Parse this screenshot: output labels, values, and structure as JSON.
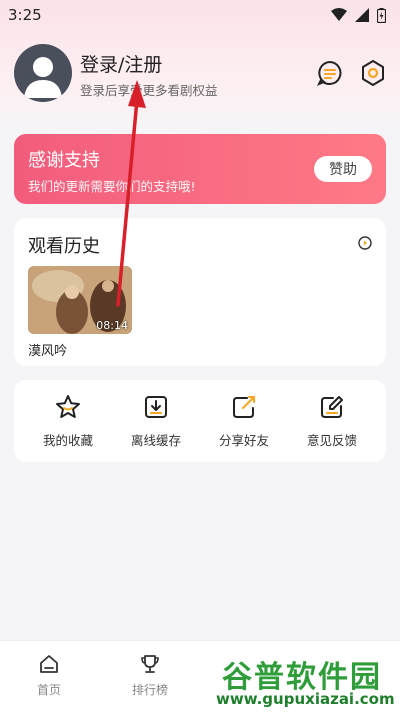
{
  "status_bar": {
    "time": "3:25"
  },
  "profile": {
    "title": "登录/注册",
    "subtitle": "登录后享受更多看剧权益"
  },
  "donate": {
    "title": "感谢支持",
    "subtitle": "我们的更新需要你们的支持哦!",
    "button": "赞助"
  },
  "history": {
    "title": "观看历史",
    "items": [
      {
        "name": "漠风吟",
        "time": "08:14"
      }
    ]
  },
  "actions": [
    {
      "label": "我的收藏",
      "icon": "star-icon"
    },
    {
      "label": "离线缓存",
      "icon": "download-icon"
    },
    {
      "label": "分享好友",
      "icon": "share-icon"
    },
    {
      "label": "意见反馈",
      "icon": "feedback-icon"
    }
  ],
  "bottom_nav": [
    {
      "label": "首页",
      "icon": "home-icon"
    },
    {
      "label": "排行榜",
      "icon": "trophy-icon"
    }
  ],
  "watermark": {
    "title": "谷普软件园",
    "url": "www.gupuxiazai.com"
  },
  "colors": {
    "accent": "#f25c7c",
    "icon_accent": "#f5a623"
  }
}
